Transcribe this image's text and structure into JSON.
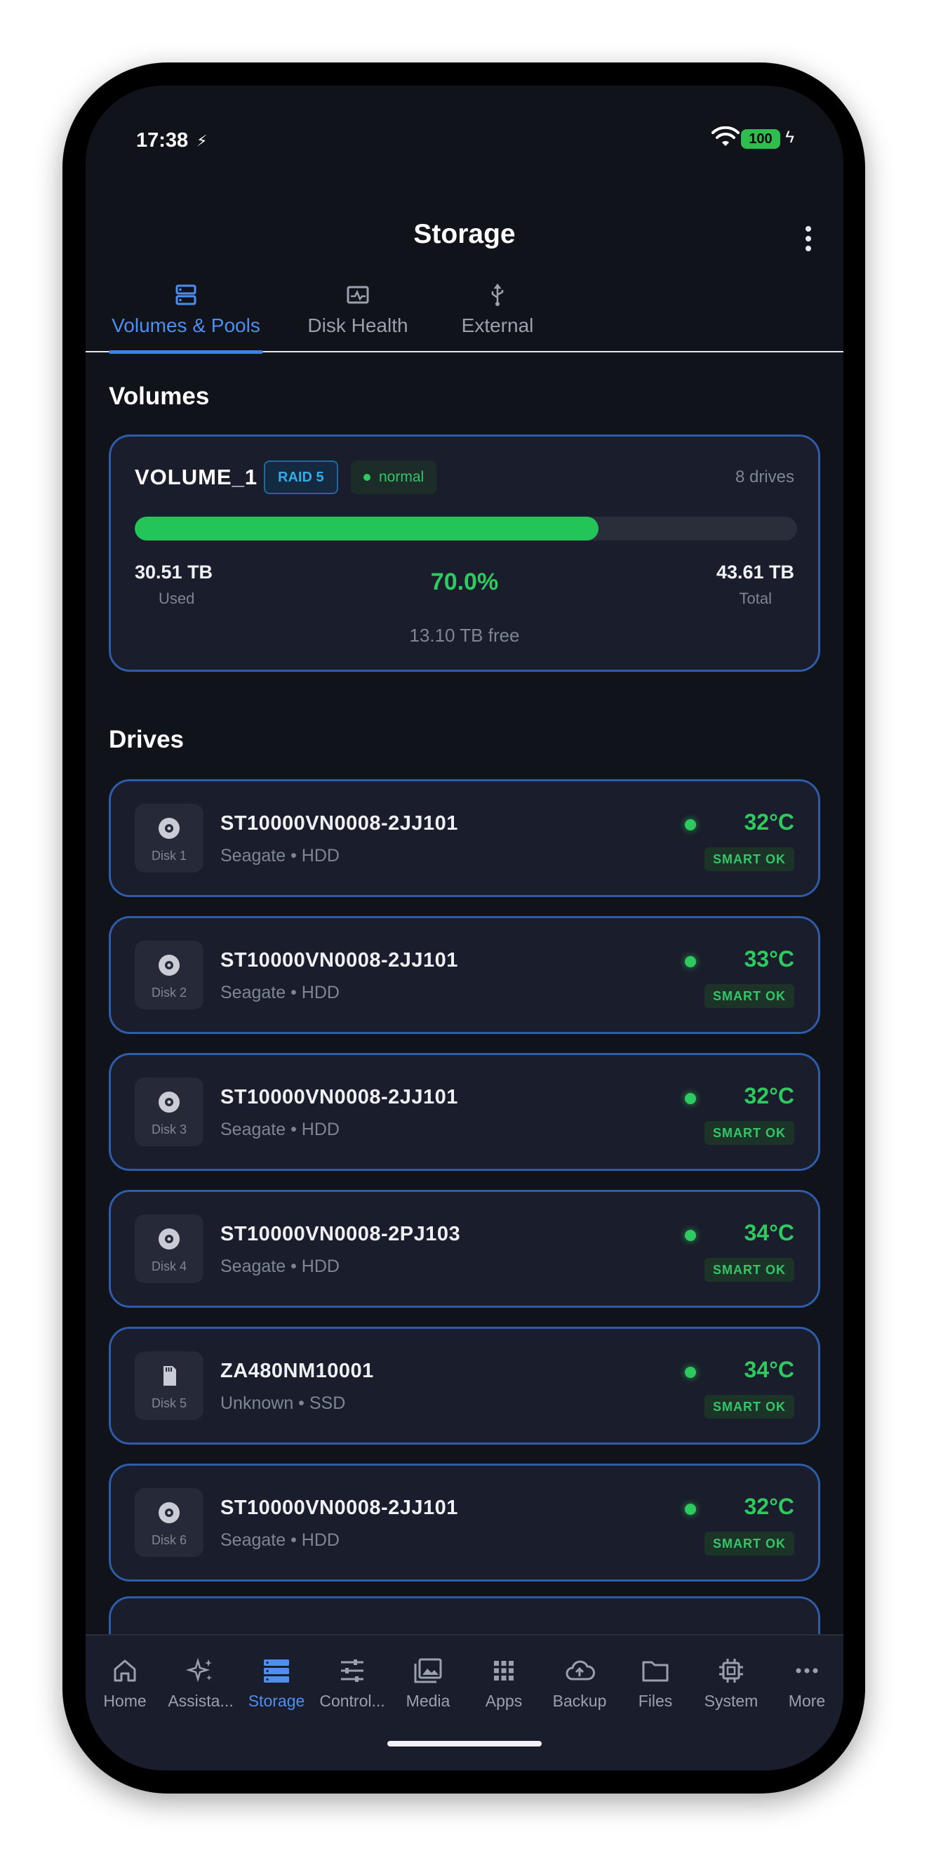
{
  "status_bar": {
    "time": "17:38",
    "sub_icon": "⚡",
    "battery": "100"
  },
  "app_bar": {
    "title": "Storage"
  },
  "tabs": [
    {
      "label": "Volumes & Pools",
      "icon": "storage-icon",
      "active": true
    },
    {
      "label": "Disk Health",
      "icon": "health-icon",
      "active": false
    },
    {
      "label": "External",
      "icon": "usb-icon",
      "active": false
    }
  ],
  "volumes_section": {
    "title": "Volumes"
  },
  "volume": {
    "name": "VOLUME_1",
    "raid": "RAID 5",
    "status": "normal",
    "drives_count": "8 drives",
    "used_value": "30.51 TB",
    "used_label": "Used",
    "percent": "70.0%",
    "usage_fraction": 0.7,
    "total_value": "43.61 TB",
    "total_label": "Total",
    "free": "13.10 TB free"
  },
  "drives_section": {
    "title": "Drives"
  },
  "drives": [
    {
      "label": "Disk 1",
      "model": "ST10000VN0008-2JJ101",
      "sub": "Seagate • HDD",
      "temp": "32°C",
      "smart": "SMART OK",
      "type": "hdd"
    },
    {
      "label": "Disk 2",
      "model": "ST10000VN0008-2JJ101",
      "sub": "Seagate • HDD",
      "temp": "33°C",
      "smart": "SMART OK",
      "type": "hdd"
    },
    {
      "label": "Disk 3",
      "model": "ST10000VN0008-2JJ101",
      "sub": "Seagate • HDD",
      "temp": "32°C",
      "smart": "SMART OK",
      "type": "hdd"
    },
    {
      "label": "Disk 4",
      "model": "ST10000VN0008-2PJ103",
      "sub": "Seagate • HDD",
      "temp": "34°C",
      "smart": "SMART OK",
      "type": "hdd"
    },
    {
      "label": "Disk 5",
      "model": "ZA480NM10001",
      "sub": "Unknown • SSD",
      "temp": "34°C",
      "smart": "SMART OK",
      "type": "ssd"
    },
    {
      "label": "Disk 6",
      "model": "ST10000VN0008-2JJ101",
      "sub": "Seagate • HDD",
      "temp": "32°C",
      "smart": "SMART OK",
      "type": "hdd"
    }
  ],
  "bottom_nav": [
    {
      "label": "Home",
      "icon": "home-icon",
      "active": false
    },
    {
      "label": "Assista...",
      "icon": "sparkle-icon",
      "active": false
    },
    {
      "label": "Storage",
      "icon": "storage-icon",
      "active": true
    },
    {
      "label": "Control...",
      "icon": "sliders-icon",
      "active": false
    },
    {
      "label": "Media",
      "icon": "media-icon",
      "active": false
    },
    {
      "label": "Apps",
      "icon": "apps-grid-icon",
      "active": false
    },
    {
      "label": "Backup",
      "icon": "cloud-upload-icon",
      "active": false
    },
    {
      "label": "Files",
      "icon": "folder-icon",
      "active": false
    },
    {
      "label": "System",
      "icon": "chip-icon",
      "active": false
    },
    {
      "label": "More",
      "icon": "more-dots-icon",
      "active": false
    }
  ],
  "colors": {
    "accent": "#4d8ef0",
    "ok_green": "#2fca5f",
    "card_border": "#2f5ca8",
    "background": "#11131a"
  }
}
